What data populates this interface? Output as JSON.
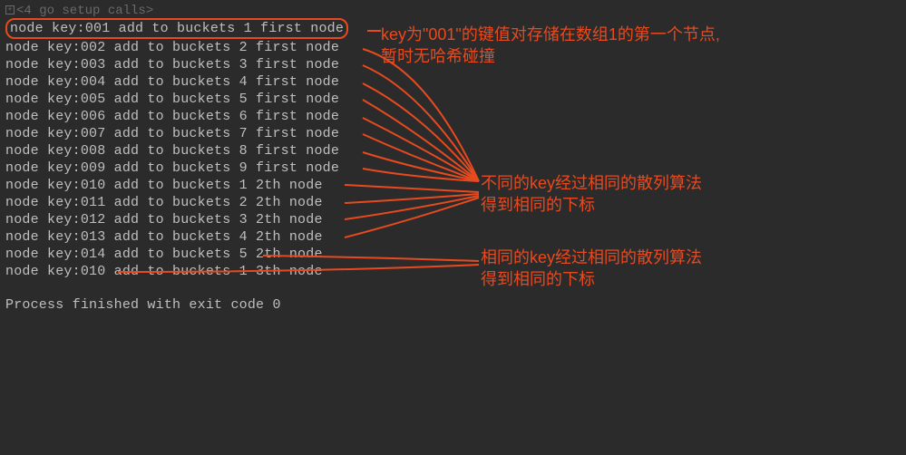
{
  "header": "<4 go setup calls>",
  "lines": [
    "node key:001 add to buckets 1 first node",
    "node key:002 add to buckets 2 first node",
    "node key:003 add to buckets 3 first node",
    "node key:004 add to buckets 4 first node",
    "node key:005 add to buckets 5 first node",
    "node key:006 add to buckets 6 first node",
    "node key:007 add to buckets 7 first node",
    "node key:008 add to buckets 8 first node",
    "node key:009 add to buckets 9 first node",
    "node key:010 add to buckets 1 2th node",
    "node key:011 add to buckets 2 2th node",
    "node key:012 add to buckets 3 2th node",
    "node key:013 add to buckets 4 2th node",
    "node key:014 add to buckets 5 2th node",
    "node key:010 add to buckets 1 3th node"
  ],
  "footer": "Process finished with exit code 0",
  "annotations": {
    "a1_l1": "key为\"001\"的键值对存储在数组1的第一个节点,",
    "a1_l2": "暂时无哈希碰撞",
    "a2_l1": "不同的key经过相同的散列算法",
    "a2_l2": "得到相同的下标",
    "a3_l1": "相同的key经过相同的散列算法",
    "a3_l2": "得到相同的下标"
  },
  "icons": {
    "expand": "+"
  }
}
